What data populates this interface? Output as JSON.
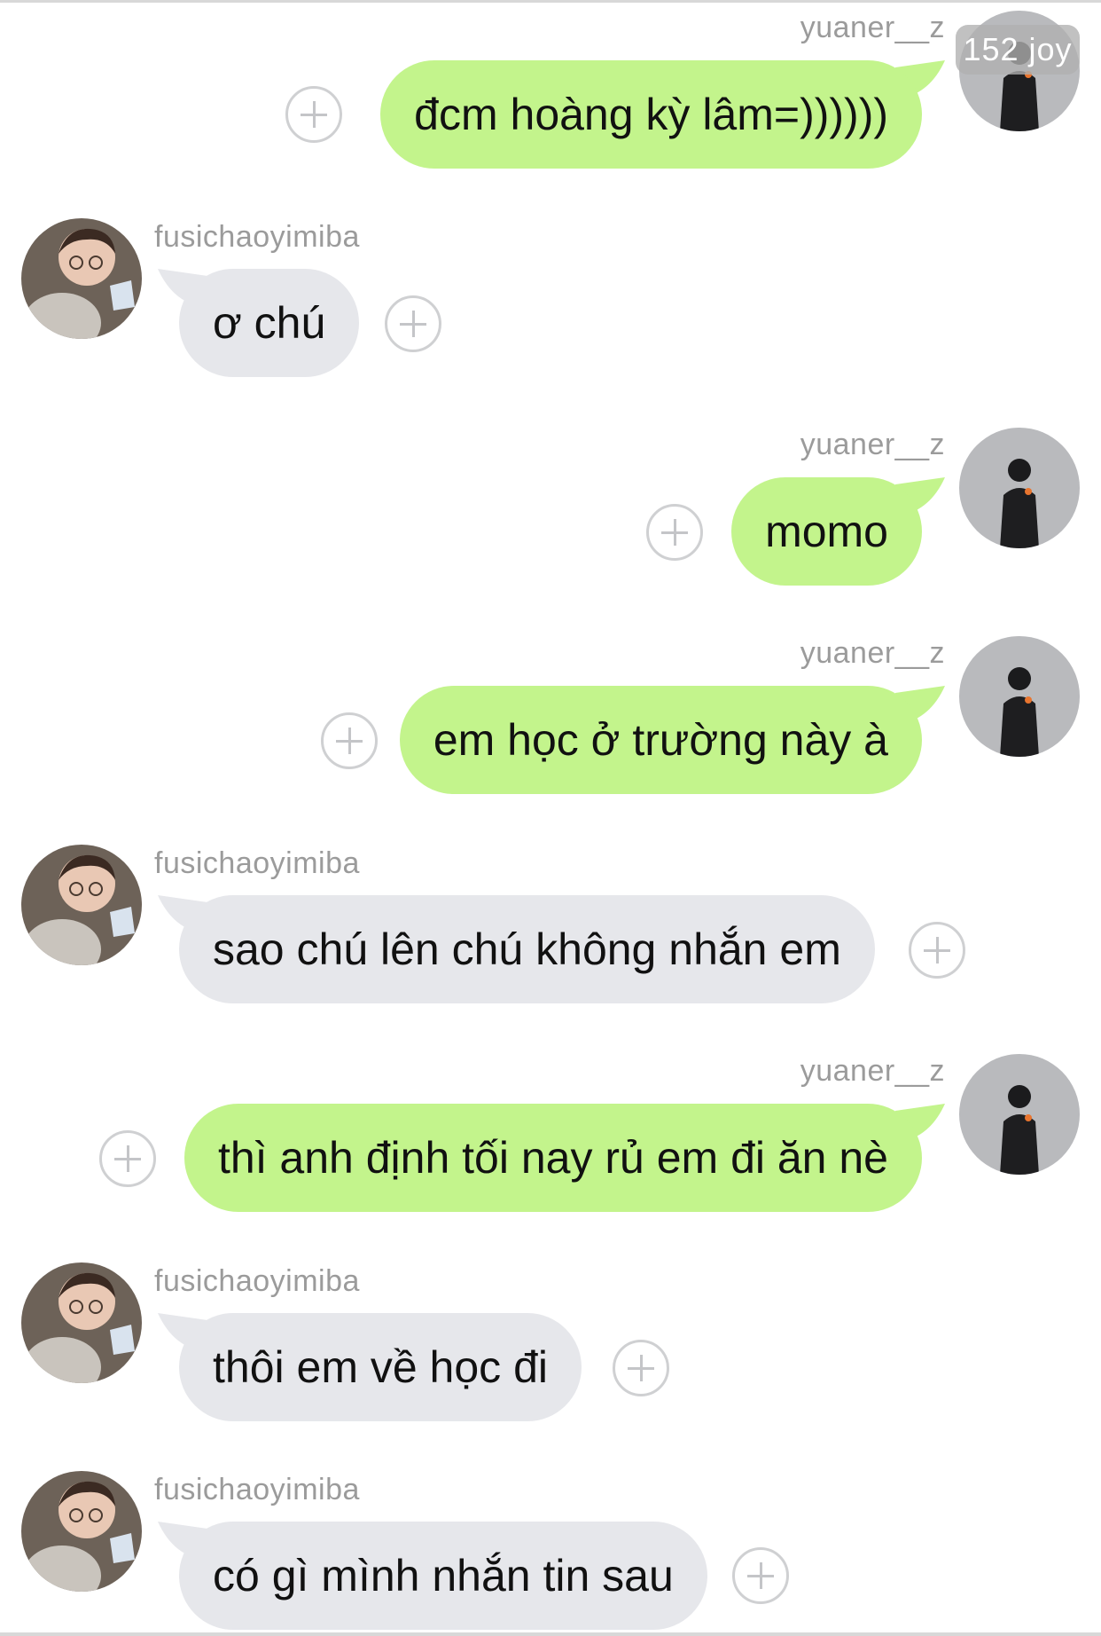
{
  "badge": {
    "label": "152 joy"
  },
  "messages": [
    {
      "sender": "yuaner__z",
      "text": "đcm hoàng kỳ lâm=))))))"
    },
    {
      "sender": "fusichaoyimiba",
      "text": "ơ chú"
    },
    {
      "sender": "yuaner__z",
      "text": "momo"
    },
    {
      "sender": "yuaner__z",
      "text": "em học ở trường này à"
    },
    {
      "sender": "fusichaoyimiba",
      "text": "sao chú lên chú không nhắn em"
    },
    {
      "sender": "yuaner__z",
      "text": "thì anh định tối nay rủ em đi ăn nè"
    },
    {
      "sender": "fusichaoyimiba",
      "text": "thôi em về học đi"
    },
    {
      "sender": "fusichaoyimiba",
      "text": "có gì mình nhắn tin sau"
    }
  ],
  "colors": {
    "outgoing_bubble": "#c3f48c",
    "incoming_bubble": "#e6e7eb",
    "username": "#9b9b9b"
  }
}
